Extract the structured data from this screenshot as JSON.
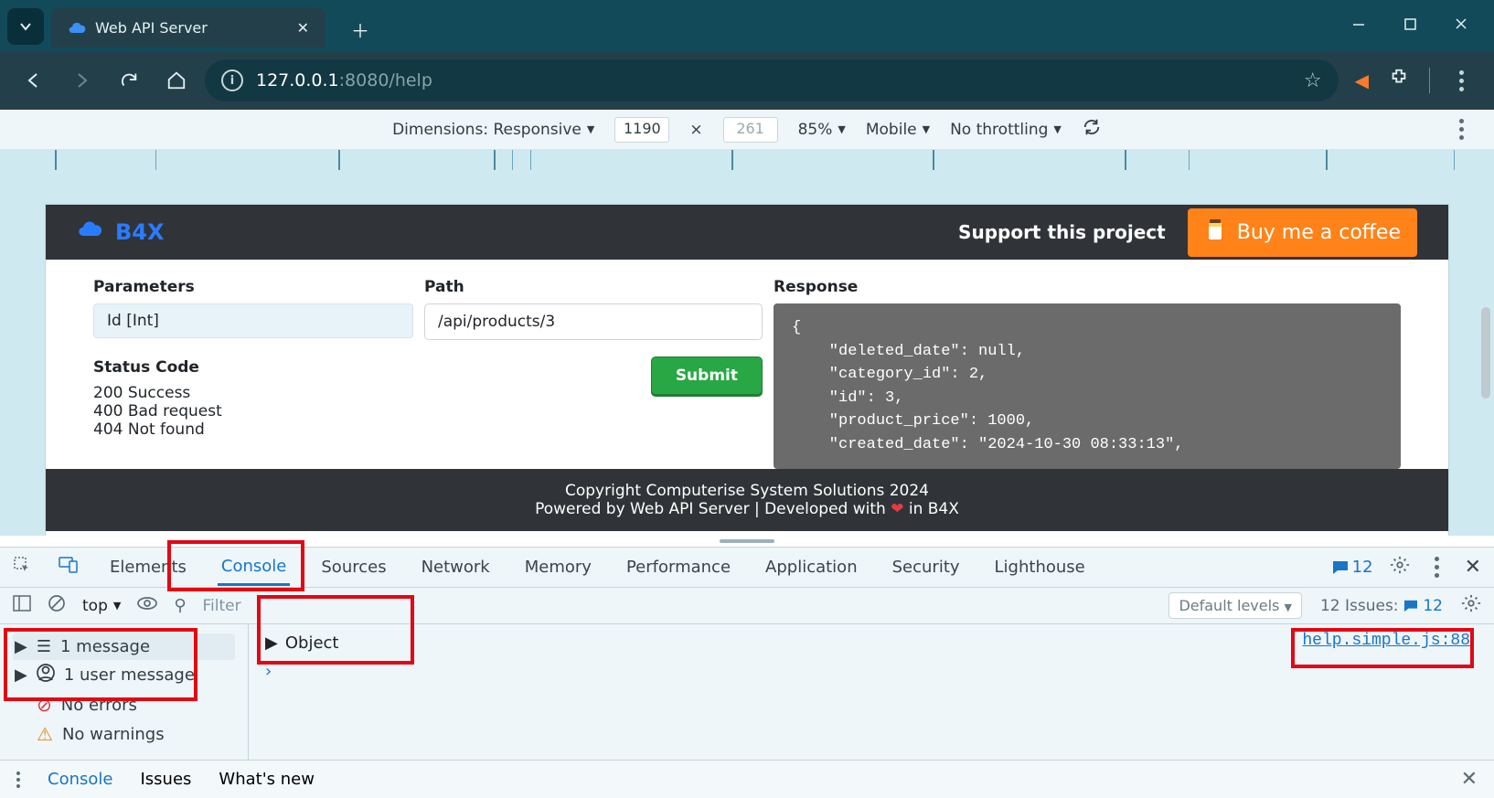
{
  "browser": {
    "tab_title": "Web API Server",
    "url_base": "127.0.0.1",
    "url_rest": ":8080/help"
  },
  "devicebar": {
    "dimensions_label": "Dimensions: Responsive",
    "width_value": "1190",
    "height_value": "261",
    "zoom": "85%",
    "device": "Mobile",
    "throttle": "No throttling"
  },
  "page": {
    "logo_text": "B4X",
    "support_text": "Support this project",
    "coffee_label": "Buy me a coffee",
    "parameters_label": "Parameters",
    "parameters_value": "Id [Int]",
    "path_label": "Path",
    "path_value": "/api/products/3",
    "submit_label": "Submit",
    "status_label": "Status Code",
    "status_codes": [
      "200 Success",
      "400 Bad request",
      "404 Not found"
    ],
    "response_label": "Response",
    "response_body": "{\n    \"deleted_date\": null,\n    \"category_id\": 2,\n    \"id\": 3,\n    \"product_price\": 1000,\n    \"created_date\": \"2024-10-30 08:33:13\",",
    "footer_line1": "Copyright Computerise System Solutions 2024",
    "footer_line2a": "Powered by Web API Server | Developed with ",
    "footer_line2b": " in B4X"
  },
  "devtools": {
    "tabs": [
      "Elements",
      "Console",
      "Sources",
      "Network",
      "Memory",
      "Performance",
      "Application",
      "Security",
      "Lighthouse"
    ],
    "active_tab": "Console",
    "msg_badge": "12",
    "console_context": "top",
    "filter_placeholder": "Filter",
    "default_levels": "Default levels",
    "issues_label": "12 Issues:",
    "issues_count": "12",
    "sidebar": {
      "messages": "1 message",
      "user_messages": "1 user message",
      "errors": "No errors",
      "warnings": "No warnings"
    },
    "object_label": "Object",
    "source_link": "help.simple.js:88"
  },
  "drawer": {
    "console": "Console",
    "issues": "Issues",
    "whatsnew": "What's new"
  }
}
